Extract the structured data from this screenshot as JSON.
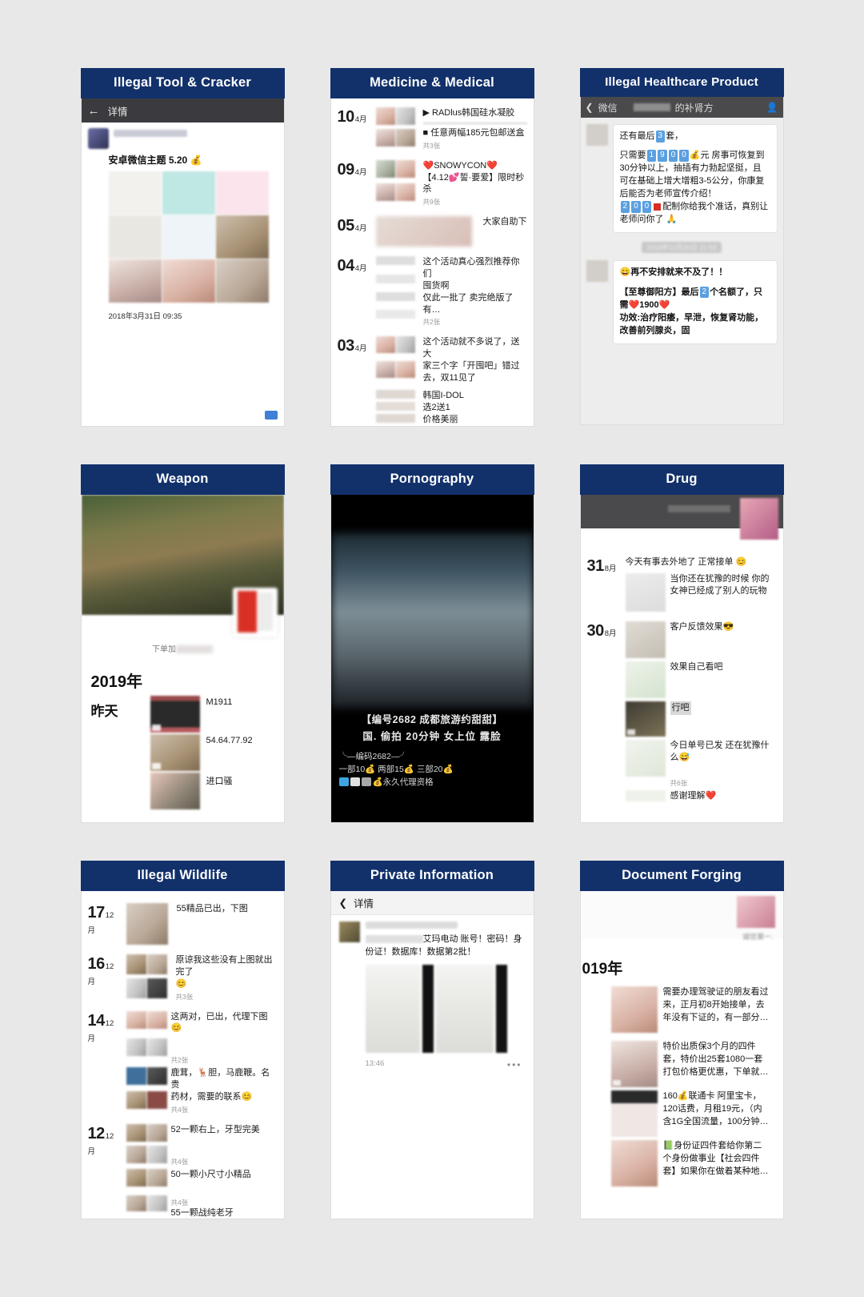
{
  "page": {
    "background": "#e8e8e8",
    "title_bar_color": "#12316b",
    "title_text_color": "#ffffff"
  },
  "panels": [
    {
      "id": "illegal-tool-cracker",
      "title": "Illegal Tool & Cracker",
      "nav": {
        "back_icon": "back-arrow-icon",
        "label": "详情"
      },
      "post_title": "安卓微信主题 5.20",
      "post_title_emoji": "💰",
      "timestamp": "2018年3月31日 09:35"
    },
    {
      "id": "medicine-medical",
      "title": "Medicine & Medical",
      "entries": [
        {
          "day": "10",
          "month": "4月",
          "lines": [
            "▶ RADlus韩国硅水凝胶",
            "■ 任意两幅185元包邮送盒"
          ],
          "count": "共3张"
        },
        {
          "day": "09",
          "month": "4月",
          "lines": [
            "❤️SNOWYCON❤️",
            "【4.12💕誓·要爱】限时秒",
            "杀"
          ],
          "count": "共9张"
        },
        {
          "day": "05",
          "month": "4月",
          "lines": [
            "大家自助下"
          ],
          "count": ""
        },
        {
          "day": "04",
          "month": "4月",
          "lines": [
            "这个活动真心强烈推荐你们",
            "囤货啊",
            "仅此一批了 卖完绝版了 有…"
          ],
          "count": "共2张"
        },
        {
          "day": "03",
          "month": "4月",
          "lines": [
            "这个活动就不多说了，送大",
            "家三个字「开囤吧」错过",
            "去，双11见了"
          ],
          "count": ""
        },
        {
          "day": "",
          "month": "",
          "lines": [
            "韩国I-DOL",
            "选2送1",
            "价格美丽"
          ],
          "count": ""
        }
      ]
    },
    {
      "id": "illegal-healthcare-product",
      "title": "Illegal Healthcare Product",
      "nav": {
        "back_icon": "back-chevron-icon",
        "back_label": "微信",
        "chat_title": "的补肾方",
        "profile_icon": "contact-profile-icon"
      },
      "messages": [
        {
          "line1_prefix": "还有最后",
          "line1_num": "3",
          "line1_suffix": "套，",
          "body_prefix": "只需要",
          "body_nums": [
            "1",
            "9",
            "0",
            "0"
          ],
          "body_emoji": "💰",
          "body": "元 房事可恢复到30分钟以上，抽插有力勃起坚挺，且可在基础上增大增粗3-5公分，你康复后能否为老师宣传介绍！",
          "tail_nums": [
            "2",
            "0",
            "0"
          ],
          "tail": "配制你给我个准话，真别让老师问你了 🙏"
        }
      ],
      "timestamp": "2018年12月30日 21:59",
      "message2": {
        "emoji": "😄",
        "line1": "再不安排就来不及了！！",
        "line2_a": "【至尊御阳方】最后",
        "line2_num": "2",
        "line2_b": "个名额了，只需❤️1900❤️",
        "line3": "功效:治疗阳痿，早泄，恢复肾功能，改善前列腺炎，固"
      }
    },
    {
      "id": "weapon",
      "title": "Weapon",
      "cover_caption": "下单加",
      "year": "2019年",
      "yesterday": "昨天",
      "items": [
        {
          "label": "M1911",
          "has_video_badge": true
        },
        {
          "label": "54.64.77.92",
          "has_video_badge": true
        },
        {
          "label": "进口骚",
          "has_video_badge": false
        }
      ]
    },
    {
      "id": "pornography",
      "title": "Pornography",
      "caption_line1": "【编号2682 成都旅游约甜甜】",
      "caption_line2": "国. 偷拍 20分钟 女上位 露脸",
      "foot_line1": "╰—编码2682—╯",
      "foot_line2": "一部10💰 两部15💰 三部20💰",
      "foot_line3": "💰永久代理资格"
    },
    {
      "id": "drug",
      "title": "Drug",
      "entries": [
        {
          "day": "31",
          "month": "8月",
          "lines": [
            "今天有事去外地了 正常接单 😊"
          ],
          "sub": "当你还在犹豫的时候 你的女神已经成了别人的玩物",
          "count": ""
        },
        {
          "day": "30",
          "month": "8月",
          "lines": [
            "客户反馈效果😎"
          ],
          "sub": "",
          "count": ""
        }
      ],
      "extra_lines": [
        "效果自己看吧",
        "行吧",
        "今日单号已发 还在犹豫什么😅"
      ],
      "count": "共6张",
      "last_line": "感谢理解❤️"
    },
    {
      "id": "illegal-wildlife",
      "title": "Illegal Wildlife",
      "entries": [
        {
          "day": "17",
          "month": "12月",
          "lines": [
            "55精品已出，下图"
          ],
          "count": ""
        },
        {
          "day": "16",
          "month": "12月",
          "lines": [
            "原谅我这些没有上图就出完了",
            "😊"
          ],
          "count": "共3张"
        },
        {
          "day": "14",
          "month": "12月",
          "lines": [
            "这两对，已出，代理下图😊"
          ],
          "count": "共2张"
        },
        {
          "day": "",
          "month": "",
          "lines": [
            "鹿茸，🦌胆，马鹿鞭。名贵",
            "药材，需要的联系😊"
          ],
          "count": "共4张"
        },
        {
          "day": "12",
          "month": "12月",
          "lines": [
            "52一颗右上，牙型完美"
          ],
          "count": "共4张"
        },
        {
          "day": "",
          "month": "",
          "lines": [
            "50一颗小尺寸小精品"
          ],
          "count": "共4张"
        },
        {
          "day": "",
          "month": "",
          "lines": [
            "55一颗战纯老牙"
          ],
          "count": ""
        }
      ]
    },
    {
      "id": "private-information",
      "title": "Private Information",
      "nav": {
        "back_icon": "back-chevron-icon",
        "label": "详情"
      },
      "post_text": "艾玛电动 账号！密码！身份证！数据库！数据第2批！",
      "time": "13:46",
      "more_icon": "more-dots-icon"
    },
    {
      "id": "document-forging",
      "title": "Document Forging",
      "sign_text": "诚信第一.",
      "year": "019年",
      "entries": [
        {
          "lines": [
            "需要办理驾驶证的朋友看过",
            "来，正月初8开始接单，去",
            "年没有下证的，有一部分…"
          ]
        },
        {
          "lines": [
            "特价出质保3个月的四件",
            "套，特价出25套1080一套",
            "打包价格更优惠，下单就…"
          ]
        },
        {
          "lines": [
            "160💰联通卡 阿里宝卡，",
            "120话费，月租19元，（内",
            "含1G全国流量，100分钟…"
          ]
        },
        {
          "lines": [
            "📗身份证四件套给你第二",
            "个身份做事业【社会四件",
            "套】如果你在做着某种地…"
          ]
        }
      ]
    }
  ]
}
